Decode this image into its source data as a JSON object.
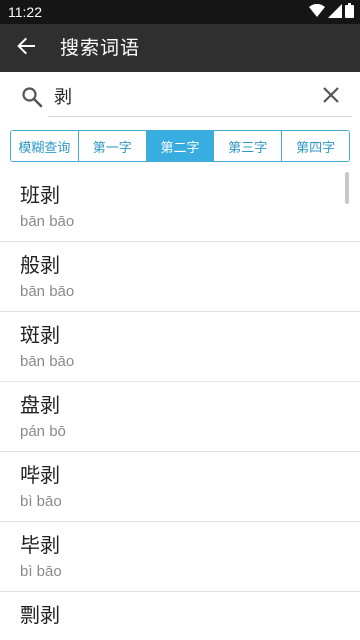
{
  "status_bar": {
    "time": "11:22",
    "icons": [
      "wifi-icon",
      "signal-icon",
      "battery-icon"
    ]
  },
  "app_bar": {
    "title": "搜索词语",
    "back_icon": "arrow-left-icon"
  },
  "search": {
    "value": "剥",
    "placeholder": "",
    "search_icon": "search-icon",
    "clear_icon": "close-icon"
  },
  "tabs": [
    {
      "label": "模糊查询",
      "active": false
    },
    {
      "label": "第一字",
      "active": false
    },
    {
      "label": "第二字",
      "active": true
    },
    {
      "label": "第三字",
      "active": false
    },
    {
      "label": "第四字",
      "active": false
    }
  ],
  "results": [
    {
      "word": "班剥",
      "pinyin": "bān bāo"
    },
    {
      "word": "般剥",
      "pinyin": "bān bāo"
    },
    {
      "word": "斑剥",
      "pinyin": "bān bāo"
    },
    {
      "word": "盘剥",
      "pinyin": "pán bō"
    },
    {
      "word": "哔剥",
      "pinyin": "bì bāo"
    },
    {
      "word": "毕剥",
      "pinyin": "bì bāo"
    },
    {
      "word": "剽剥",
      "pinyin": ""
    }
  ],
  "colors": {
    "accent": "#38ade0",
    "app_bar": "#2f2f2f",
    "status_bar": "#151515"
  }
}
